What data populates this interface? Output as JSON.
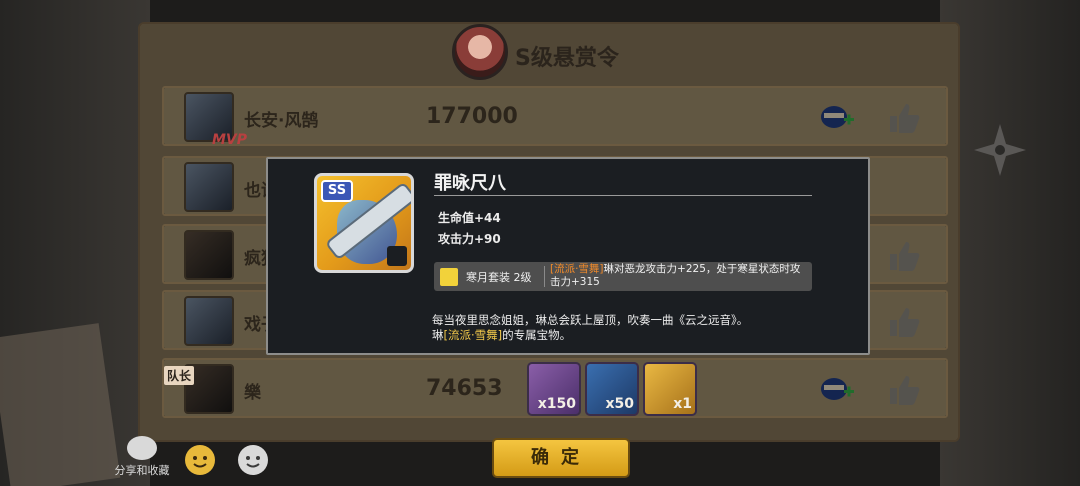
{
  "header": {
    "title": "S级悬赏令"
  },
  "badges": {
    "mvp": "MVP",
    "captain": "队长"
  },
  "rows": [
    {
      "name": "长安·风鹄",
      "score": "177000"
    },
    {
      "name": "也语",
      "score": ""
    },
    {
      "name": "疯狗",
      "score": ""
    },
    {
      "name": "戏子",
      "score": ""
    },
    {
      "name": "樂",
      "score": "74653"
    }
  ],
  "rewards": [
    {
      "icon": "sakura-icon",
      "qty": "x150"
    },
    {
      "icon": "scroll-icon",
      "qty": "x50"
    },
    {
      "icon": "chest-icon",
      "qty": "x1"
    }
  ],
  "modal": {
    "rarity": "SS",
    "name": "罪咏尺八",
    "stats": [
      "生命值+44",
      "攻击力+90"
    ],
    "set": {
      "label": "寒月套装 2级",
      "tag": "[流派·雪舞]",
      "desc": "琳对恶龙攻击力+225，处于寒星状态时攻击力+315"
    },
    "story_line1": "每当夜里思念姐姐，琳总会跃上屋顶，吹奏一曲《云之远音》。",
    "story_pre": "琳",
    "story_tag": "[流派·雪舞]",
    "story_post": "的专属宝物。"
  },
  "footer": {
    "share_label": "分享和收藏",
    "confirm_label": "确定"
  },
  "colors": {
    "accent_gold": "#f4c540",
    "set_tag": "#f08a2a",
    "story_tag": "#f1c84a"
  }
}
